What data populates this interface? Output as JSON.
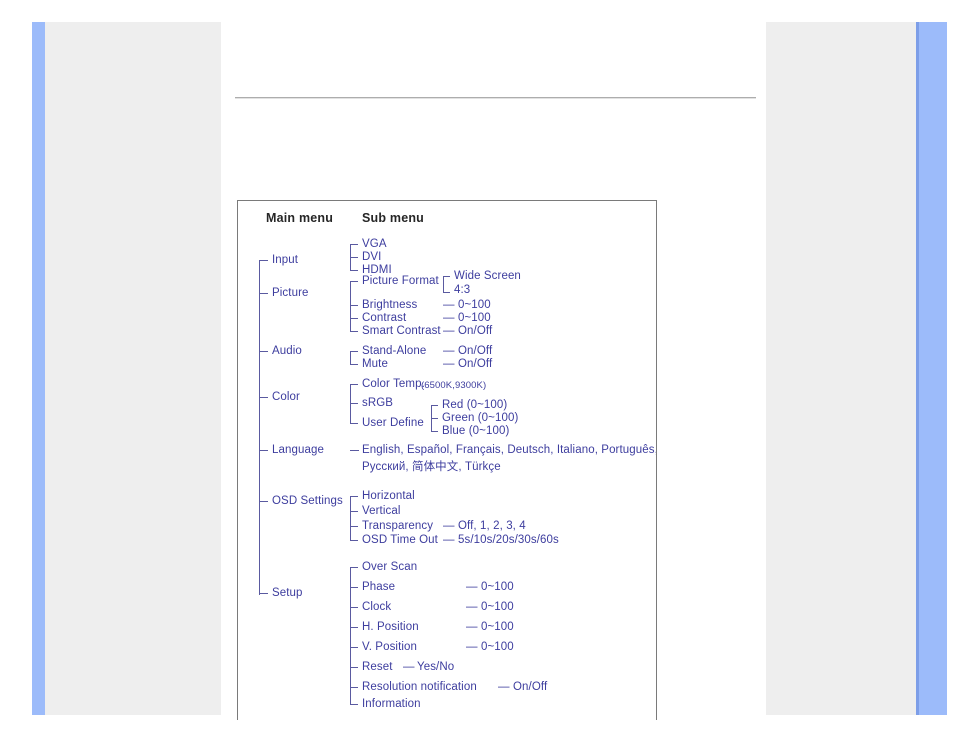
{
  "page": {
    "accent_blue": "#9cbbfa",
    "band_gray": "#eeeeee",
    "diagram_text_color": "#3d3d9e",
    "header_text_color": "#262626"
  },
  "diagram": {
    "headers": {
      "main_menu": "Main menu",
      "sub_menu": "Sub menu"
    },
    "main_items": [
      "Input",
      "Picture",
      "Audio",
      "Color",
      "Language",
      "OSD Settings",
      "Setup"
    ],
    "input": {
      "items": [
        "VGA",
        "DVI",
        "HDMI"
      ]
    },
    "picture": {
      "picture_format": "Picture Format",
      "picture_format_options": [
        "Wide Screen",
        "4:3"
      ],
      "brightness": "Brightness",
      "brightness_value": "0~100",
      "contrast": "Contrast",
      "contrast_value": "0~100",
      "smart_contrast": "Smart Contrast",
      "smart_contrast_value": "On/Off",
      "dash": "—"
    },
    "audio": {
      "stand_alone": "Stand-Alone",
      "stand_alone_value": "On/Off",
      "mute": "Mute",
      "mute_value": "On/Off"
    },
    "color": {
      "color_temp": "Color Temp.",
      "color_temp_values": "(6500K,9300K)",
      "srgb": "sRGB",
      "user_define": "User Define",
      "user_define_items": [
        "Red (0~100)",
        "Green (0~100)",
        "Blue (0~100)"
      ]
    },
    "language": {
      "line1": "English, Español, Français, Deutsch, Italiano, Português,",
      "line2_latin_a": "Русский, ",
      "line2_cjk": "简体中文",
      "line2_latin_b": ", Türkçe"
    },
    "osd_settings": {
      "horizontal": "Horizontal",
      "vertical": "Vertical",
      "transparency": "Transparency",
      "transparency_values": "Off, 1, 2, 3, 4",
      "osd_time_out": "OSD Time Out",
      "osd_time_out_values": "5s/10s/20s/30s/60s"
    },
    "setup": {
      "over_scan": "Over Scan",
      "phase": "Phase",
      "phase_value": "0~100",
      "clock": "Clock",
      "clock_value": "0~100",
      "h_position": "H. Position",
      "h_position_value": "0~100",
      "v_position": "V. Position",
      "v_position_value": "0~100",
      "reset": "Reset",
      "reset_value": "Yes/No",
      "resolution_notification": "Resolution notification",
      "resolution_notification_value": "On/Off",
      "information": "Information"
    }
  }
}
